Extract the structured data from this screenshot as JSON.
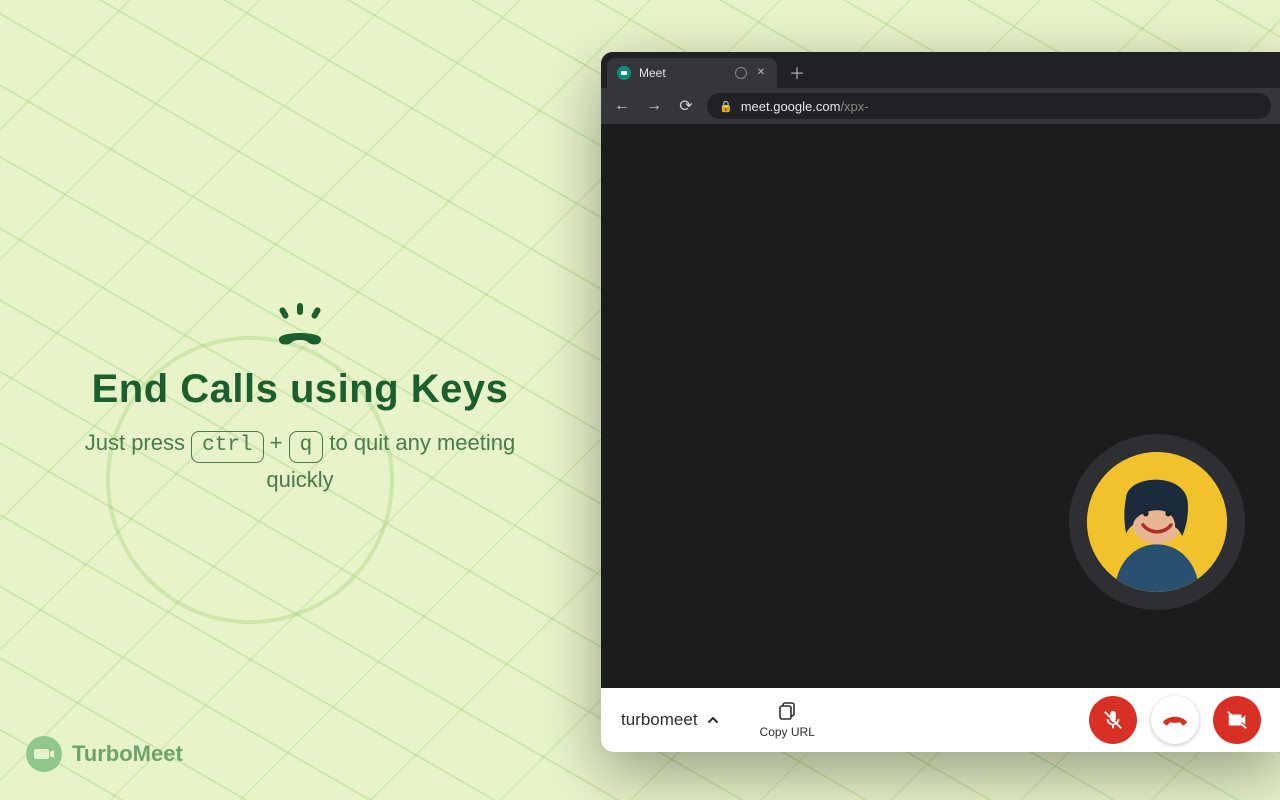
{
  "hero": {
    "title": "End Calls using Keys",
    "subtitle_pre": "Just press ",
    "key1": "ctrl",
    "plus": " + ",
    "key2": "q",
    "subtitle_post": " to quit any meeting quickly"
  },
  "brand": {
    "name": "TurboMeet"
  },
  "browser": {
    "tab_title": "Meet",
    "url_host": "meet.google.com",
    "url_path": "/xpx-"
  },
  "meet": {
    "meeting_name": "turbomeet",
    "copy_label": "Copy URL",
    "controls": {
      "mic": "mic-off",
      "hangup": "hangup",
      "cam": "cam-off"
    }
  }
}
